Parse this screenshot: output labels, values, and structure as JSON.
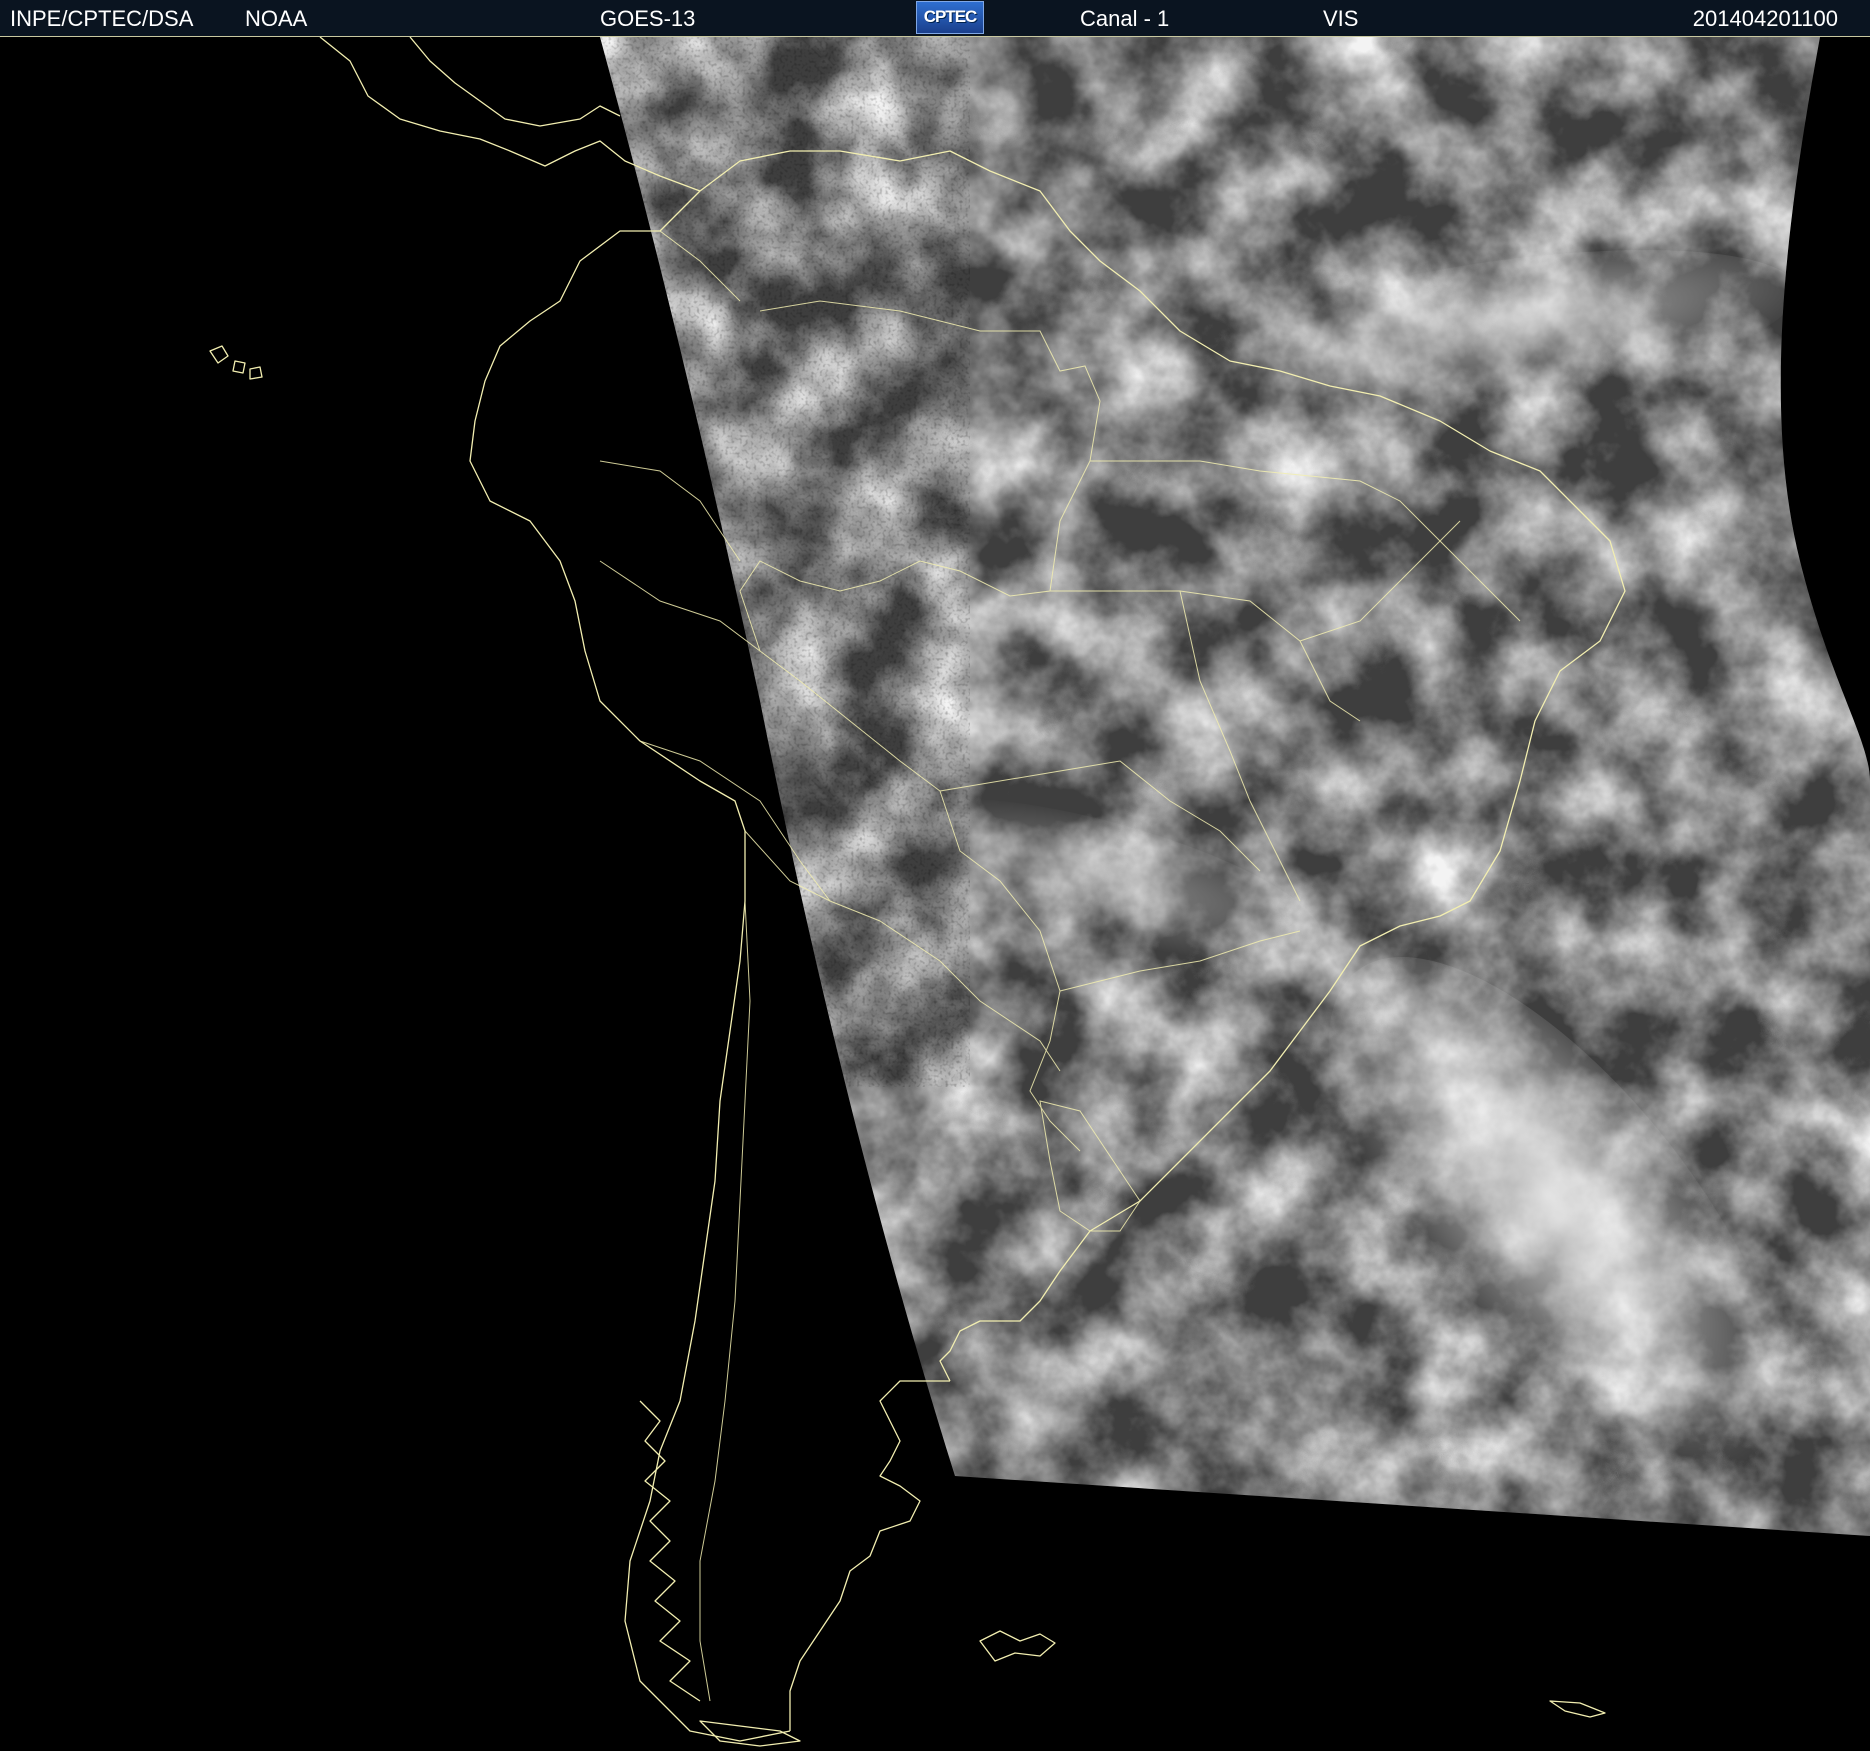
{
  "header": {
    "organization": "INPE/CPTEC/DSA",
    "agency": "NOAA",
    "satellite": "GOES-13",
    "logo_text": "CPTEC",
    "channel": "Canal - 1",
    "band": "VIS",
    "timestamp": "201404201100"
  },
  "imagery": {
    "type": "visible satellite image",
    "background_color": "#000000",
    "coastline_color": "#f2eeb0",
    "cloud_color": "#e6e6e6",
    "swath_base_color": "#3c3c3c"
  }
}
